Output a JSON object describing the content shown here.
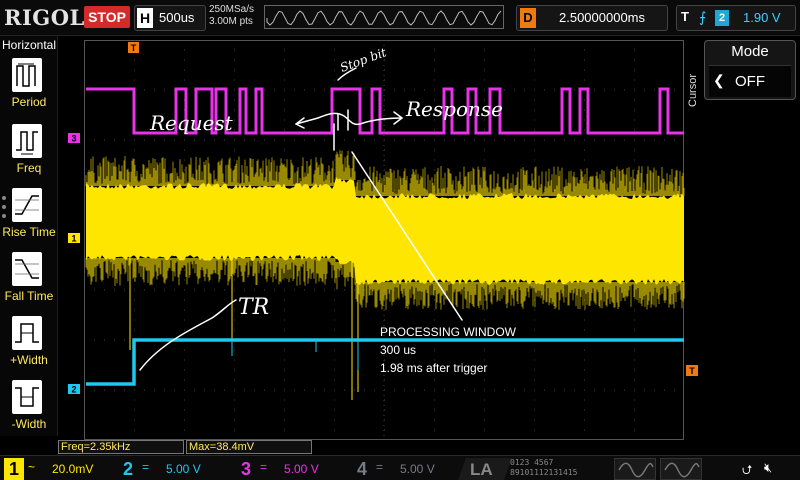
{
  "header": {
    "brand": "RIGOL",
    "run_state": "STOP",
    "timebase_tag": "H",
    "timebase": "500us",
    "sample_rate": "250MSa/s",
    "memory_depth": "3.00M pts",
    "trigger_pos_tag": "T",
    "delay_tag": "D",
    "delay": "2.50000000ms",
    "trigger_tag": "T",
    "trigger_edge": "rising-edge-icon",
    "trigger_source": "2",
    "trigger_level": "1.90 V"
  },
  "sidebar": {
    "title": "Horizontal",
    "items": [
      {
        "label": "Period",
        "icon": "period-icon"
      },
      {
        "label": "Freq",
        "icon": "freq-icon"
      },
      {
        "label": "Rise Time",
        "icon": "rise-time-icon"
      },
      {
        "label": "Fall Time",
        "icon": "fall-time-icon"
      },
      {
        "label": "+Width",
        "icon": "pos-width-icon"
      },
      {
        "label": "-Width",
        "icon": "neg-width-icon"
      }
    ]
  },
  "right_panel": {
    "tab": "Cursor",
    "mode_label": "Mode",
    "mode_value": "OFF"
  },
  "markers": {
    "ch3": "3",
    "ch1": "1",
    "ch2": "2",
    "trigger_level": "T",
    "trigger_time": "T"
  },
  "annotations": {
    "stop_bit": "Stop bit",
    "request": "Request",
    "response": "Response",
    "tr": "TR",
    "processing_window": "PROCESSING WINDOW",
    "duration": "300 us",
    "after_trigger": "1.98 ms after trigger"
  },
  "measurements": {
    "freq": "Freq=2.35kHz",
    "max": "Max=38.4mV"
  },
  "channels": [
    {
      "num": "1",
      "coupling": "~",
      "scale": "20.0mV",
      "color": "#ffe600"
    },
    {
      "num": "2",
      "coupling": "=",
      "scale": "5.00 V",
      "color": "#1fc8f0"
    },
    {
      "num": "3",
      "coupling": "=",
      "scale": "5.00 V",
      "color": "#e833e8"
    },
    {
      "num": "4",
      "coupling": "=",
      "scale": "5.00 V",
      "color": "#7a7a8a"
    }
  ],
  "la": {
    "label": "LA",
    "row1": "0123 4567",
    "row2": "89101112131415"
  },
  "colors": {
    "ch1": "#ffe600",
    "ch2": "#1fc8f0",
    "ch3": "#e833e8",
    "trigger": "#f07a10",
    "grid": "#3a3a3a"
  }
}
